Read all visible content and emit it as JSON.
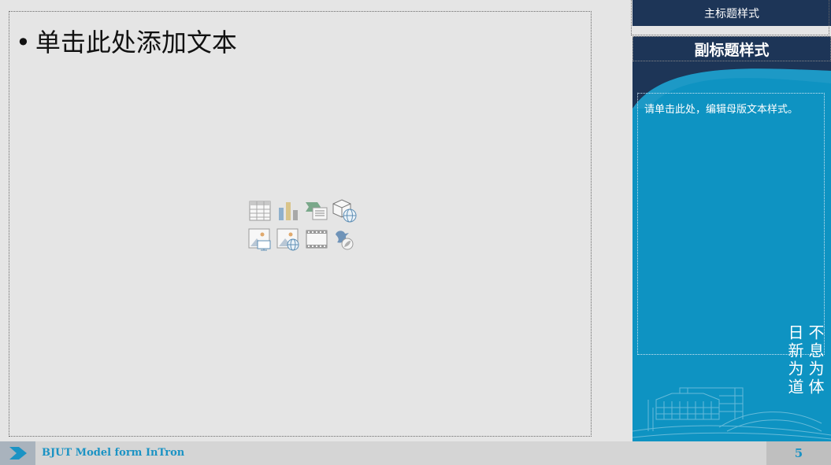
{
  "content": {
    "bullet_text": "单击此处添加文本",
    "insert_icons": [
      "table-icon",
      "chart-icon",
      "smartart-icon",
      "3d-model-icon",
      "picture-icon",
      "online-picture-icon",
      "video-icon",
      "icons-icon"
    ]
  },
  "sidebar": {
    "title": "主标题样式",
    "subtitle": "副标题样式",
    "body_text": "请单击此处，编辑母版文本样式。",
    "calligraphy_col1": "不息为体",
    "calligraphy_col2": "日新为道"
  },
  "footer": {
    "brand_text": "BJUT Model form InTron",
    "page_number": "5"
  },
  "colors": {
    "navy": "#1d3557",
    "blue": "#0e93c2",
    "accent_text": "#1b93c4"
  }
}
